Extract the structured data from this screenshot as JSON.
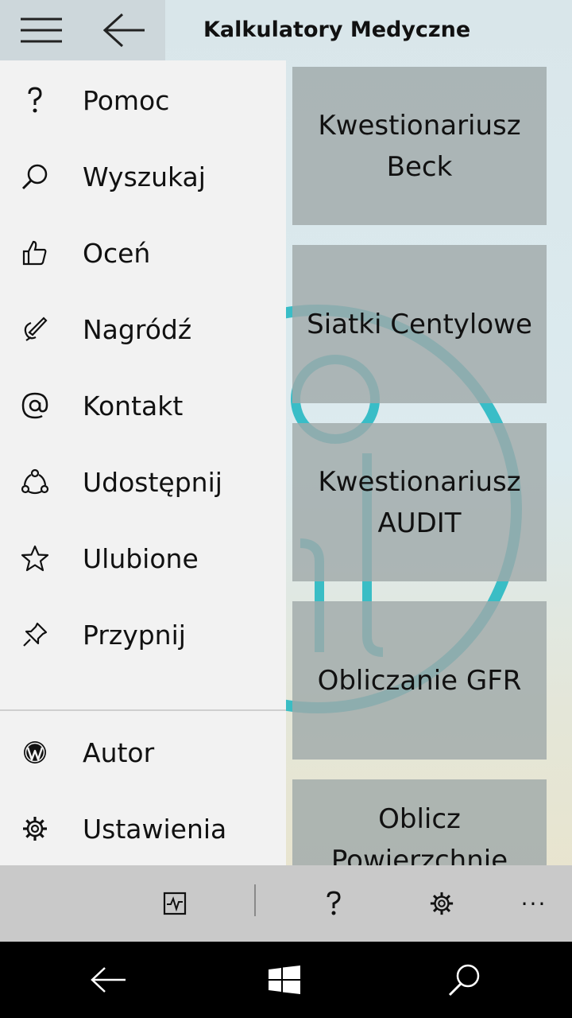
{
  "header": {
    "title": "Kalkulatory Medyczne",
    "menu_icon": "hamburger-icon",
    "back_icon": "back-arrow-icon"
  },
  "tiles": [
    {
      "label": "Kwestionariusz Beck"
    },
    {
      "label": "Siatki Centylowe"
    },
    {
      "label": "Kwestionariusz AUDIT"
    },
    {
      "label": "Obliczanie GFR"
    },
    {
      "label": "Oblicz Powierzchnie"
    }
  ],
  "menu": {
    "items": [
      {
        "label": "Pomoc",
        "icon": "help-icon"
      },
      {
        "label": "Wyszukaj",
        "icon": "search-icon"
      },
      {
        "label": "Oceń",
        "icon": "thumbs-up-icon"
      },
      {
        "label": "Nagródź",
        "icon": "pen-icon"
      },
      {
        "label": "Kontakt",
        "icon": "at-icon"
      },
      {
        "label": "Udostępnij",
        "icon": "share-icon"
      },
      {
        "label": "Ulubione",
        "icon": "star-icon"
      },
      {
        "label": "Przypnij",
        "icon": "pin-icon"
      }
    ],
    "bottom_items": [
      {
        "label": "Autor",
        "icon": "wordpress-icon"
      },
      {
        "label": "Ustawienia",
        "icon": "settings-icon"
      }
    ]
  },
  "appbar": {
    "icons": [
      "pulse-icon",
      "help-icon",
      "settings-icon",
      "more-icon"
    ],
    "more_label": "···"
  },
  "navbar": {
    "icons": [
      "back-icon",
      "windows-icon",
      "search-icon"
    ]
  },
  "colors": {
    "accent": "#1cb5bf",
    "pane_bg": "#f2f2f2",
    "appbar_bg": "#c9c9c9"
  }
}
